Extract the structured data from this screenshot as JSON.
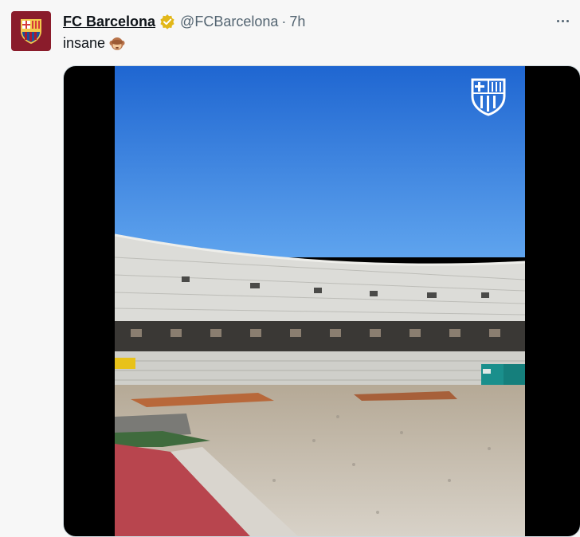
{
  "tweet": {
    "author_name": "FC Barcelona",
    "handle": "@FCBarcelona",
    "separator": "·",
    "time": "7h",
    "text": "insane",
    "verified_badge": "gold-verified-badge-icon",
    "emoji": "see-no-evil-monkey-emoji",
    "more_icon": "more-options-icon"
  },
  "colors": {
    "club_maroon": "#8a1c2b",
    "club_blue": "#1d4f9a",
    "sky": "#2f7be0",
    "badge_gold": "#e2b719"
  }
}
